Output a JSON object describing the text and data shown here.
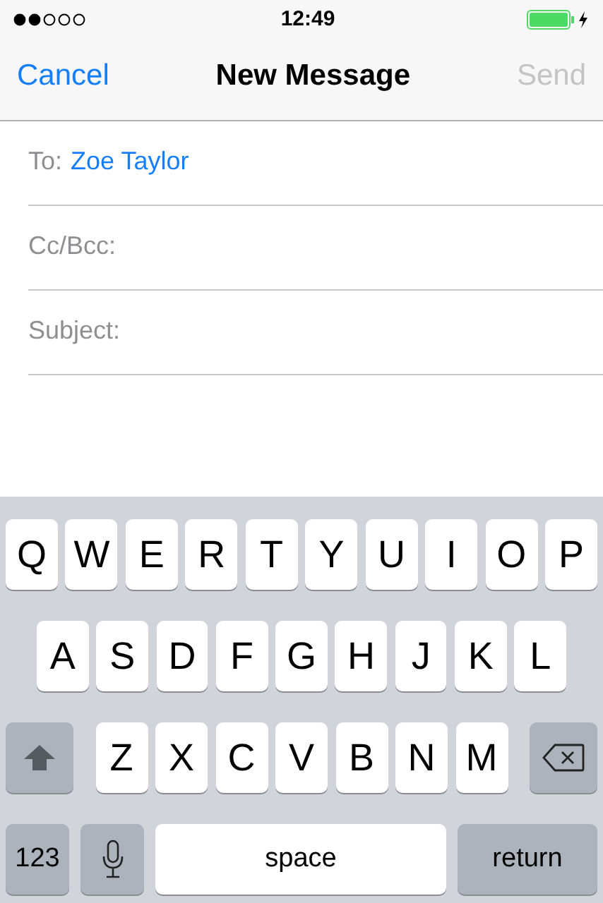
{
  "status_bar": {
    "time": "12:49"
  },
  "nav": {
    "cancel": "Cancel",
    "title": "New Message",
    "send": {
      "label": "Send",
      "disabled": true
    }
  },
  "fields": [
    {
      "label": "To:",
      "value": "Zoe Taylor"
    },
    {
      "label": "Cc/Bcc:"
    },
    {
      "label": "Subject:"
    }
  ],
  "keyboard": {
    "rows": [
      {
        "keys": [
          {
            "kind": "letter",
            "label": "Q"
          },
          {
            "kind": "letter",
            "label": "W"
          },
          {
            "kind": "letter",
            "label": "E"
          },
          {
            "kind": "letter",
            "label": "R"
          },
          {
            "kind": "letter",
            "label": "T"
          },
          {
            "kind": "letter",
            "label": "Y"
          },
          {
            "kind": "letter",
            "label": "U"
          },
          {
            "kind": "letter",
            "label": "I"
          },
          {
            "kind": "letter",
            "label": "O"
          },
          {
            "kind": "letter",
            "label": "P"
          }
        ]
      },
      {
        "keys": [
          {
            "kind": "letter",
            "label": "A"
          },
          {
            "kind": "letter",
            "label": "S"
          },
          {
            "kind": "letter",
            "label": "D"
          },
          {
            "kind": "letter",
            "label": "F"
          },
          {
            "kind": "letter",
            "label": "G"
          },
          {
            "kind": "letter",
            "label": "H"
          },
          {
            "kind": "letter",
            "label": "J"
          },
          {
            "kind": "letter",
            "label": "K"
          },
          {
            "kind": "letter",
            "label": "L"
          }
        ]
      },
      {
        "keys": [
          {
            "kind": "shift"
          },
          {
            "kind": "letter",
            "label": "Z"
          },
          {
            "kind": "letter",
            "label": "X"
          },
          {
            "kind": "letter",
            "label": "C"
          },
          {
            "kind": "letter",
            "label": "V"
          },
          {
            "kind": "letter",
            "label": "B"
          },
          {
            "kind": "letter",
            "label": "N"
          },
          {
            "kind": "letter",
            "label": "M"
          },
          {
            "kind": "delete"
          }
        ]
      },
      {
        "keys": [
          {
            "kind": "numbers",
            "label": "123"
          },
          {
            "kind": "mic"
          },
          {
            "kind": "space",
            "label": "space"
          },
          {
            "kind": "return",
            "label": "return"
          }
        ]
      }
    ]
  }
}
